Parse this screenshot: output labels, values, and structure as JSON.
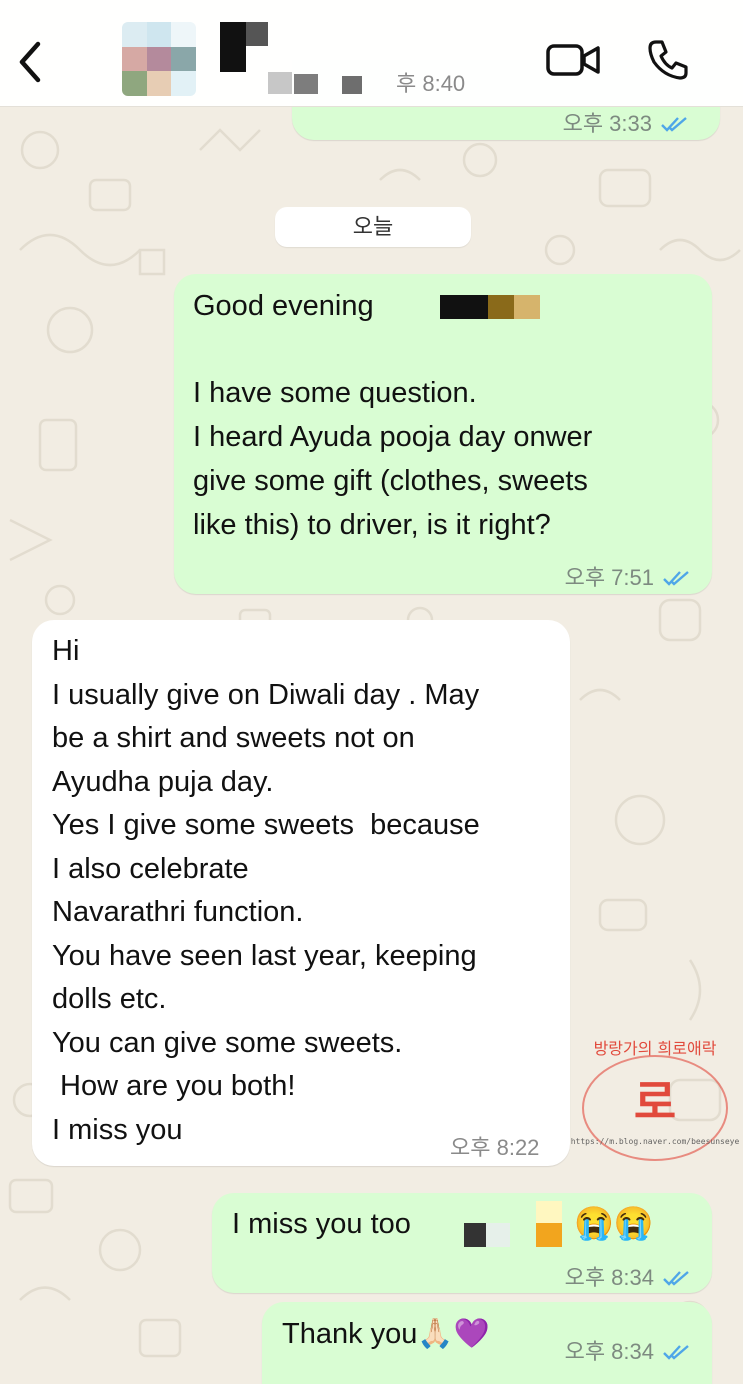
{
  "header": {
    "back_label": "",
    "last_seen": "후 8:40",
    "video_icon": "video-camera-icon",
    "call_icon": "phone-icon"
  },
  "messages": {
    "prev_out": {
      "time": "오후 3:33"
    },
    "date_separator": "오늘",
    "msg1": {
      "direction": "outgoing",
      "greeting": "Good evening",
      "lines": [
        "I have some question.",
        "I heard Ayuda pooja day onwer",
        "give some gift (clothes, sweets",
        "like this) to driver, is it right?"
      ],
      "time": "오후 7:51"
    },
    "msg2": {
      "direction": "incoming",
      "lines": [
        "Hi",
        "I usually give on Diwali day . May",
        "be a shirt and sweets not on",
        "Ayudha puja day.",
        "Yes I give some sweets  because",
        "I also celebrate",
        "Navarathri function.",
        "You have seen last year, keeping",
        "dolls etc.",
        "You can give some sweets.",
        " How are you both!",
        "I miss you"
      ],
      "time": "오후 8:22"
    },
    "msg3": {
      "direction": "outgoing",
      "text": "I miss you too",
      "emoji": "😭😭",
      "time": "오후 8:34"
    },
    "msg4": {
      "direction": "outgoing",
      "text": "Thank you🙏🏻💜",
      "time": "오후 8:34"
    }
  },
  "watermark": {
    "top_text": "방랑가의 희로애락",
    "center_char": "로",
    "bottom_text": "https://m.blog.naver.com/beesunseye"
  },
  "colors": {
    "outgoing_bubble": "#d9fdd3",
    "incoming_bubble": "#ffffff",
    "read_ticks": "#4fa6e8",
    "background": "#f2ede3",
    "stamp_red": "#e0392b"
  }
}
